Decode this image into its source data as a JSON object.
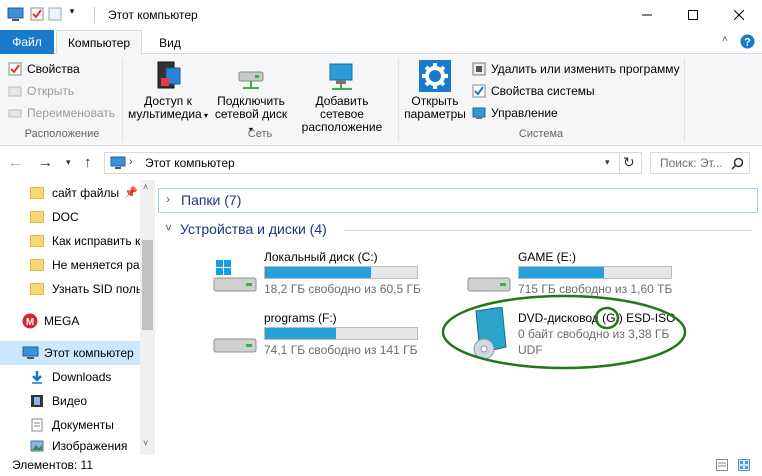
{
  "window": {
    "title": "Этот компьютер"
  },
  "ribbon_tabs": {
    "file": "Файл",
    "computer": "Компьютер",
    "view": "Вид"
  },
  "ribbon": {
    "location": {
      "properties": "Свойства",
      "open": "Открыть",
      "rename": "Переименовать",
      "group": "Расположение"
    },
    "network": {
      "media_line1": "Доступ к",
      "media_line2": "мультимедиа",
      "map_line1": "Подключить",
      "map_line2": "сетевой диск",
      "add_line1": "Добавить сетевое",
      "add_line2": "расположение",
      "group": "Сеть"
    },
    "system": {
      "open_line1": "Открыть",
      "open_line2": "параметры",
      "uninstall": "Удалить или изменить программу",
      "sysprops": "Свойства системы",
      "manage": "Управление",
      "group": "Система"
    }
  },
  "address": {
    "path": "Этот компьютер",
    "search_placeholder": "Поиск: Эт..."
  },
  "sidebar": {
    "quick": [
      "сайт файлы",
      "DOC",
      "Как исправить к",
      "Не меняется ра",
      "Узнать SID поль"
    ],
    "mega": "MEGA",
    "this_pc": "Этот компьютер",
    "places": [
      "Downloads",
      "Видео",
      "Документы",
      "Изображения"
    ]
  },
  "groups": {
    "folders": "Папки (7)",
    "devices": "Устройства и диски (4)"
  },
  "drives": [
    {
      "name": "Локальный диск (C:)",
      "free": "18,2 ГБ свободно из 60,5 ГБ",
      "used_fraction": 0.7
    },
    {
      "name": "GAME (E:)",
      "free": "715 ГБ свободно из 1,60 ТБ",
      "used_fraction": 0.56
    },
    {
      "name": "programs (F:)",
      "free": "74,1 ГБ свободно из 141 ГБ",
      "used_fraction": 0.47
    }
  ],
  "dvd": {
    "name": "DVD-дисковод (G:) ESD-ISO",
    "free": "0 байт свободно из 3,38 ГБ",
    "fs": "UDF"
  },
  "status": {
    "items": "Элементов: 11"
  },
  "colors": {
    "accent": "#1979ca",
    "bar": "#26a0da",
    "annotation": "#1f7a16"
  }
}
